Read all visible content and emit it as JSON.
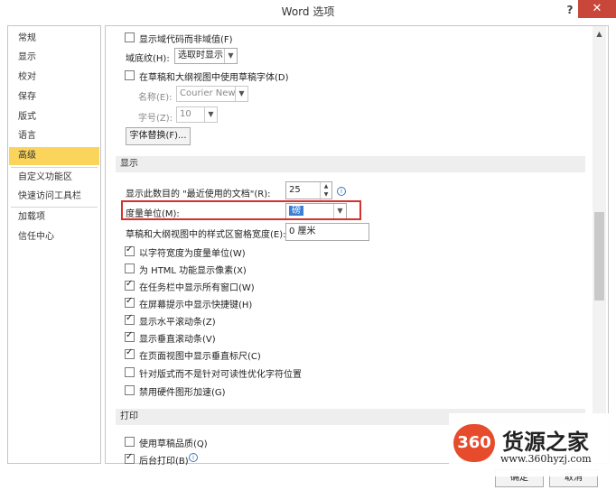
{
  "window": {
    "title": "Word 选项",
    "help_label": "?",
    "close_label": "✕"
  },
  "sidebar": {
    "items": [
      {
        "label": "常规"
      },
      {
        "label": "显示"
      },
      {
        "label": "校对"
      },
      {
        "label": "保存"
      },
      {
        "label": "版式"
      },
      {
        "label": "语言"
      },
      {
        "label": "高级",
        "active": true
      },
      {
        "label": "自定义功能区"
      },
      {
        "label": "快速访问工具栏"
      },
      {
        "label": "加载项"
      },
      {
        "label": "信任中心"
      }
    ]
  },
  "general": {
    "field_codes": {
      "label": "显示域代码而非域值(F)",
      "checked": false
    },
    "field_shading": {
      "label": "域底纹(H):",
      "value": "选取时显示"
    },
    "draft_font": {
      "label": "在草稿和大纲视图中使用草稿字体(D)",
      "checked": false
    },
    "font_name": {
      "label": "名称(E):",
      "value": "Courier New"
    },
    "font_size": {
      "label": "字号(Z):",
      "value": "10"
    },
    "font_substitution_button": "字体替换(F)..."
  },
  "display": {
    "section_title": "显示",
    "recent_docs": {
      "label": "显示此数目的 \"最近使用的文档\"(R):",
      "value": "25"
    },
    "measurement_units": {
      "label": "度量单位(M):",
      "value": "磅"
    },
    "style_area_width": {
      "label": "草稿和大纲视图中的样式区窗格宽度(E):",
      "value": "0 厘米"
    },
    "options": [
      {
        "label": "以字符宽度为度量单位(W)",
        "checked": true
      },
      {
        "label": "为 HTML 功能显示像素(X)",
        "checked": false
      },
      {
        "label": "在任务栏中显示所有窗口(W)",
        "checked": true
      },
      {
        "label": "在屏幕提示中显示快捷键(H)",
        "checked": true
      },
      {
        "label": "显示水平滚动条(Z)",
        "checked": true
      },
      {
        "label": "显示垂直滚动条(V)",
        "checked": true
      },
      {
        "label": "在页面视图中显示垂直标尺(C)",
        "checked": true
      },
      {
        "label": "针对版式而不是针对可读性优化字符位置",
        "checked": false
      },
      {
        "label": "禁用硬件图形加速(G)",
        "checked": false
      }
    ]
  },
  "print": {
    "section_title": "打印",
    "options": [
      {
        "label": "使用草稿品质(Q)",
        "checked": false
      },
      {
        "label": "后台打印(B)",
        "checked": true
      }
    ]
  },
  "footer": {
    "ok_label": "确定",
    "cancel_label": "取消"
  },
  "watermark": {
    "badge": "360",
    "title": "货源之家",
    "url": "www.360hyzj.com"
  },
  "icons": {
    "info_icon": "i",
    "dropdown_icon": "▼",
    "scroll_up_icon": "▲"
  },
  "colors": {
    "active_sidebar": "#fbd45c",
    "highlight_border": "#d3322f",
    "close_button": "#c8473a"
  }
}
